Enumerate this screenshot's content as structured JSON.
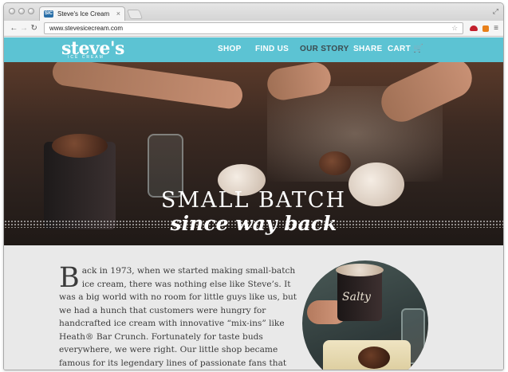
{
  "browser": {
    "tab": {
      "favicon_text": "SIC",
      "title": "Steve's Ice Cream",
      "close": "×"
    },
    "address": {
      "url": "www.stevesicecream.com"
    },
    "nav": {
      "back": "←",
      "forward": "→",
      "reload": "↻"
    },
    "icons": [
      "star-icon",
      "extension-red-icon",
      "extension-orange-icon",
      "menu-icon"
    ]
  },
  "site": {
    "brand": {
      "logo": "steve's",
      "tagline": "ICE CREAM"
    },
    "menu": [
      {
        "label": "SHOP",
        "active": false
      },
      {
        "label": "FIND US",
        "active": false
      },
      {
        "label": "OUR STORY",
        "active": true
      },
      {
        "label": "SHARE",
        "active": false
      },
      {
        "label": "CART",
        "active": false
      }
    ],
    "colors": {
      "nav": "#5cc3d3",
      "active_menu": "#3c4b50"
    },
    "hero": {
      "title": "SMALL BATCH",
      "subtitle": "since way back"
    },
    "story": {
      "dropcap": "B",
      "body": "ack in 1973, when we started making small-batch ice cream, there was nothing else like Steve’s. It was a big world with no room for little guys like us, but we had a hunch that customers were hungry for handcrafted ice cream with innovative “mix-ins” like Heath® Bar Crunch. Fortunately for taste buds everywhere, we were right. Our little shop became famous for its legendary lines of passionate fans that formed even during snowstorms, and"
    },
    "photo_label": "Salty"
  }
}
